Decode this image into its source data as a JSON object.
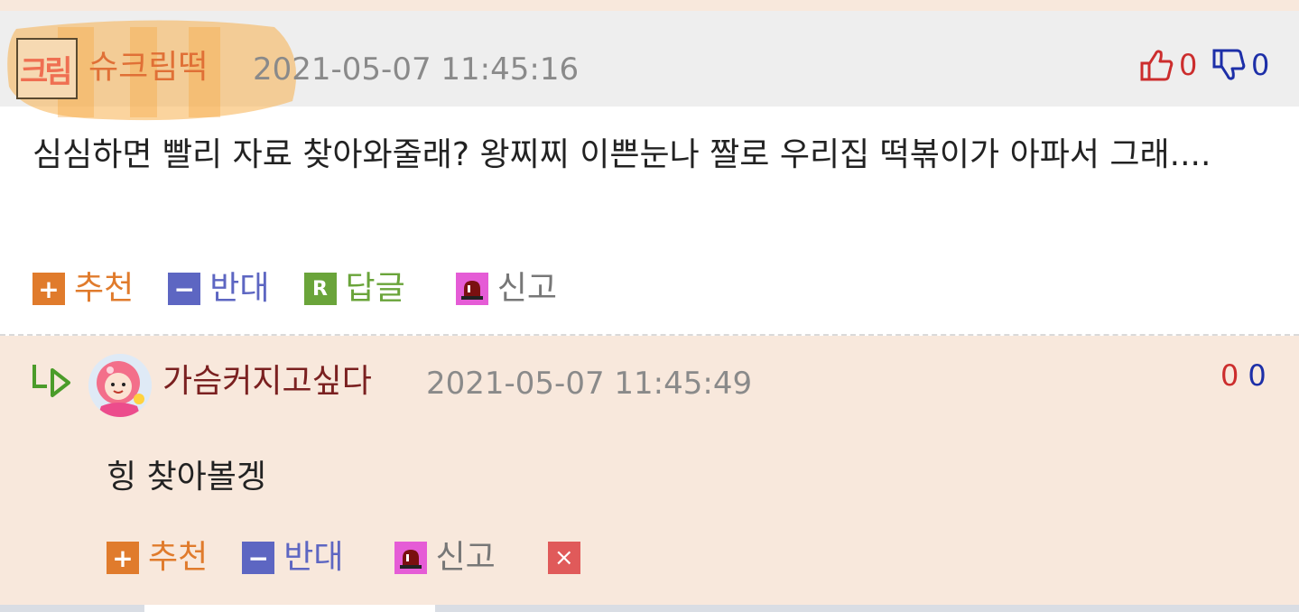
{
  "comment": {
    "nickname": "슈크림떡",
    "avatar_text": "크림",
    "timestamp": "2021-05-07 11:45:16",
    "upvotes": "0",
    "downvotes": "0",
    "body": "심심하면 빨리 자료 찾아와줄래? 왕찌찌 이쁜눈나 짤로 우리집 떡볶이가 아파서 그래....",
    "actions": {
      "recommend": "추천",
      "oppose": "반대",
      "reply": "답글",
      "report": "신고"
    },
    "action_icons": {
      "recommend": "+",
      "oppose": "−",
      "reply": "R"
    }
  },
  "reply": {
    "nickname": "가슴커지고싶다",
    "timestamp": "2021-05-07 11:45:49",
    "upvotes": "0",
    "downvotes": "0",
    "body": "힝 찾아볼겡",
    "actions": {
      "recommend": "추천",
      "oppose": "반대",
      "report": "신고"
    },
    "action_icons": {
      "recommend": "+",
      "oppose": "−",
      "delete": "×"
    }
  },
  "icons": {
    "thumbs_up": "thumbs-up-icon",
    "thumbs_down": "thumbs-down-icon",
    "reply_arrow": "reply-arrow-icon",
    "report": "siren-icon",
    "delete": "close-icon"
  },
  "colors": {
    "recommend": "#e07b2c",
    "oppose": "#5d66c2",
    "reply": "#6aa43a",
    "report": "#e55cd6",
    "delete": "#e05a5a",
    "up_count": "#cc2d2d",
    "down_count": "#1d2fa8",
    "nickname_1": "#e07036",
    "nickname_2": "#7a2020",
    "reply_background": "#f8e8dc"
  }
}
